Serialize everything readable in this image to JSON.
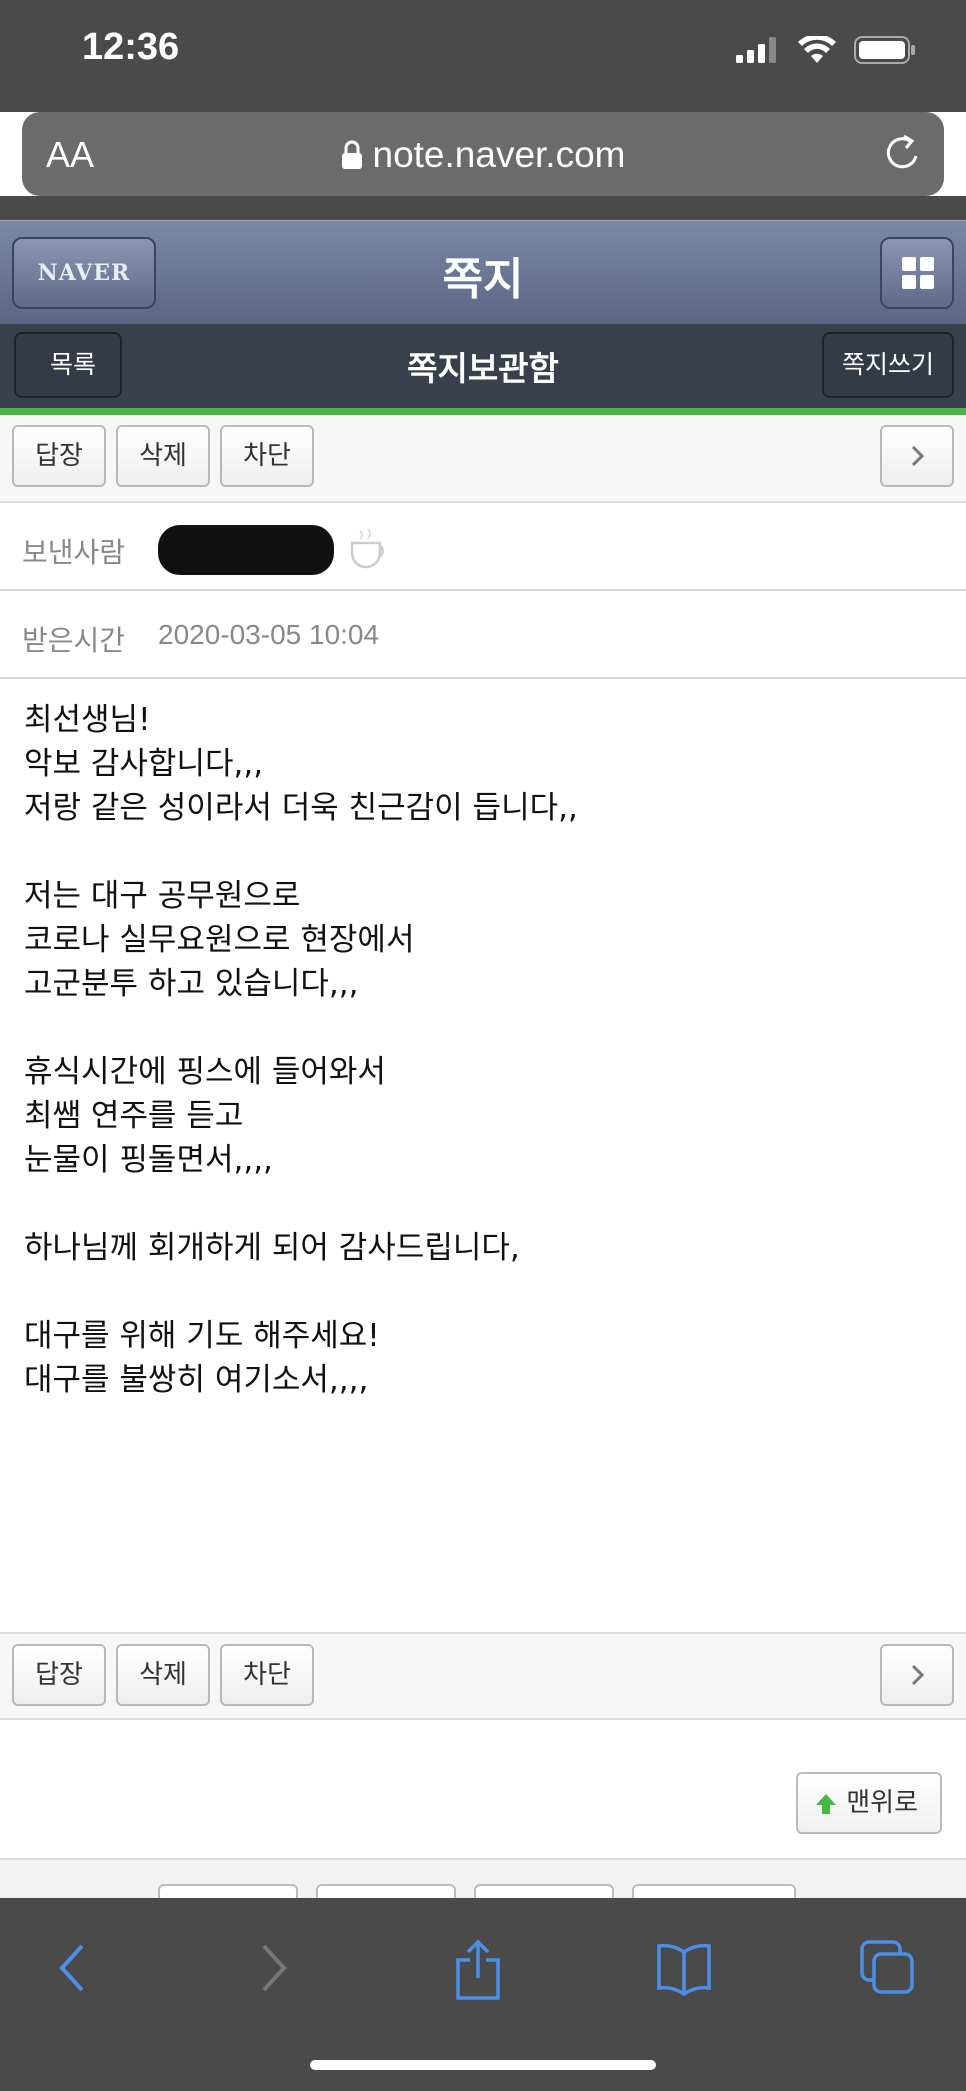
{
  "status_bar": {
    "time": "12:36"
  },
  "browser": {
    "aa_label": "AA",
    "url": "note.naver.com"
  },
  "app_header": {
    "naver_label": "NAVER",
    "title": "쪽지"
  },
  "sub_header": {
    "back_label": "목록",
    "title": "쪽지보관함",
    "write_label": "쪽지쓰기"
  },
  "actions": {
    "reply": "답장",
    "delete": "삭제",
    "block": "차단"
  },
  "message": {
    "sender_label": "보낸사람",
    "received_label": "받은시간",
    "received_time": "2020-03-05 10:04",
    "lines": [
      "최선생님!",
      "악보 감사합니다,,,",
      "저랑 같은 성이라서 더욱 친근감이 듭니다,,",
      "",
      "저는 대구 공무원으로",
      "코로나 실무요원으로 현장에서",
      "고군분투 하고 있습니다,,,",
      "",
      "휴식시간에 핑스에 들어와서",
      "최쌤 연주를 듣고",
      "눈물이 핑돌면서,,,,",
      "",
      "하나님께 회개하게 되어 감사드립니다,",
      "",
      "대구를 위해 기도 해주세요!",
      "대구를 불쌍히 여기소서,,,,"
    ]
  },
  "footer": {
    "top_label": "맨위로"
  },
  "colors": {
    "accent_green": "#47b743",
    "header_blue": "#6b7794",
    "subheader": "#3a3f4d"
  }
}
